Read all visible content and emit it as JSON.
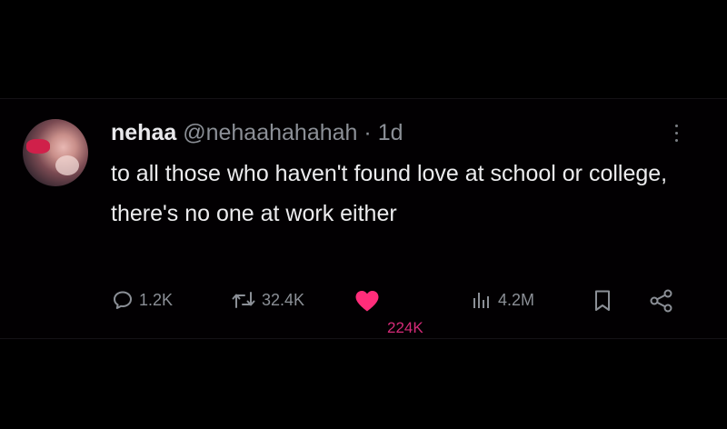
{
  "tweet": {
    "author_name": "nehaa",
    "handle": "@nehaahahahah",
    "separator": "·",
    "age": "1d",
    "text": "to all those who haven't found love at school or college, there's no one at work either"
  },
  "actions": {
    "reply_count": "1.2K",
    "retweet_count": "32.4K",
    "like_count": "224K",
    "views_count": "4.2M"
  },
  "icons": {
    "reply": "reply-icon",
    "retweet": "retweet-icon",
    "like": "heart-icon",
    "views": "views-icon",
    "bookmark": "bookmark-icon",
    "share": "share-icon",
    "more": "more-options-icon"
  },
  "colors": {
    "background": "#000000",
    "text": "#ececee",
    "muted": "#8b8f96",
    "like": "#ff2d7a"
  }
}
